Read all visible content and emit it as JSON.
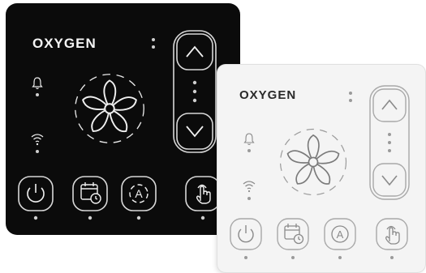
{
  "brand": {
    "name": "OXYGEN"
  },
  "colors": {
    "dark_panel_bg": "#0b0b0b",
    "dark_panel_fg": "#f4f4f4",
    "light_panel_bg": "#f4f4f4",
    "light_panel_fg": "#6e6e6e",
    "light_panel_brand": "#2a2a2a"
  },
  "icons": {
    "status_indicators": [
      "bell-icon",
      "wifi-icon"
    ],
    "center": "fan-icon",
    "side_control": [
      "chevron-up-icon",
      "chevron-down-icon"
    ],
    "bottom_buttons": [
      "power-icon",
      "calendar-clock-icon",
      "auto-mode-icon",
      "touch-hand-icon"
    ]
  },
  "panels": [
    {
      "id": "dark",
      "theme": "dark",
      "mode_button_letter": "A"
    },
    {
      "id": "light",
      "theme": "light",
      "mode_button_letter": "A"
    }
  ]
}
